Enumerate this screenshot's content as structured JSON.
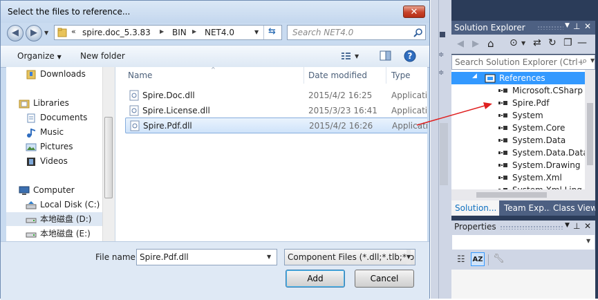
{
  "dialog": {
    "title": "Select the files to reference...",
    "close_glyph": "✕",
    "breadcrumb": {
      "overflow": "«",
      "parts": [
        "spire.doc_5.3.83",
        "BIN",
        "NET4.0"
      ],
      "separator": "▶"
    },
    "search_placeholder": "Search NET4.0",
    "toolbar": {
      "organize_label": "Organize",
      "new_folder_label": "New folder"
    },
    "nav_items": [
      {
        "label": "Downloads",
        "icon": "downloads-folder-icon"
      },
      {
        "label": "Libraries",
        "icon": "libraries-icon"
      },
      {
        "label": "Documents",
        "icon": "documents-icon"
      },
      {
        "label": "Music",
        "icon": "music-icon"
      },
      {
        "label": "Pictures",
        "icon": "pictures-icon"
      },
      {
        "label": "Videos",
        "icon": "videos-icon"
      },
      {
        "label": "Computer",
        "icon": "computer-icon"
      },
      {
        "label": "Local Disk (C:)",
        "icon": "local-disk-icon"
      },
      {
        "label": "本地磁盘 (D:)",
        "icon": "drive-icon"
      },
      {
        "label": "本地磁盘 (E:)",
        "icon": "drive-icon"
      }
    ],
    "columns": {
      "name": "Name",
      "date": "Date modified",
      "type": "Type"
    },
    "files": [
      {
        "name": "Spire.Doc.dll",
        "date": "2015/4/2 16:25",
        "type": "Applicatio",
        "selected": false
      },
      {
        "name": "Spire.License.dll",
        "date": "2015/3/23 16:41",
        "type": "Applicatio",
        "selected": false
      },
      {
        "name": "Spire.Pdf.dll",
        "date": "2015/4/2 16:26",
        "type": "Applicatio",
        "selected": true
      }
    ],
    "file_name_label": "File name:",
    "file_name_value": "Spire.Pdf.dll",
    "filter_value": "Component Files (*.dll;*.tlb;*.ol",
    "add_label": "Add",
    "cancel_label": "Cancel"
  },
  "solution_explorer": {
    "title": "Solution Explorer",
    "search_placeholder": "Search Solution Explorer (Ctrl+;",
    "references_label": "References",
    "references": [
      "Microsoft.CSharp",
      "Spire.Pdf",
      "System",
      "System.Core",
      "System.Data",
      "System.Data.DataSe",
      "System.Drawing",
      "System.Xml",
      "System.Xml.Linq"
    ],
    "tabs": [
      "Solution...",
      "Team Exp...",
      "Class View"
    ]
  },
  "properties": {
    "title": "Properties"
  },
  "colors": {
    "arrow": "#e02020",
    "selection": "#3399ff",
    "vs_header": "#4d6082"
  }
}
